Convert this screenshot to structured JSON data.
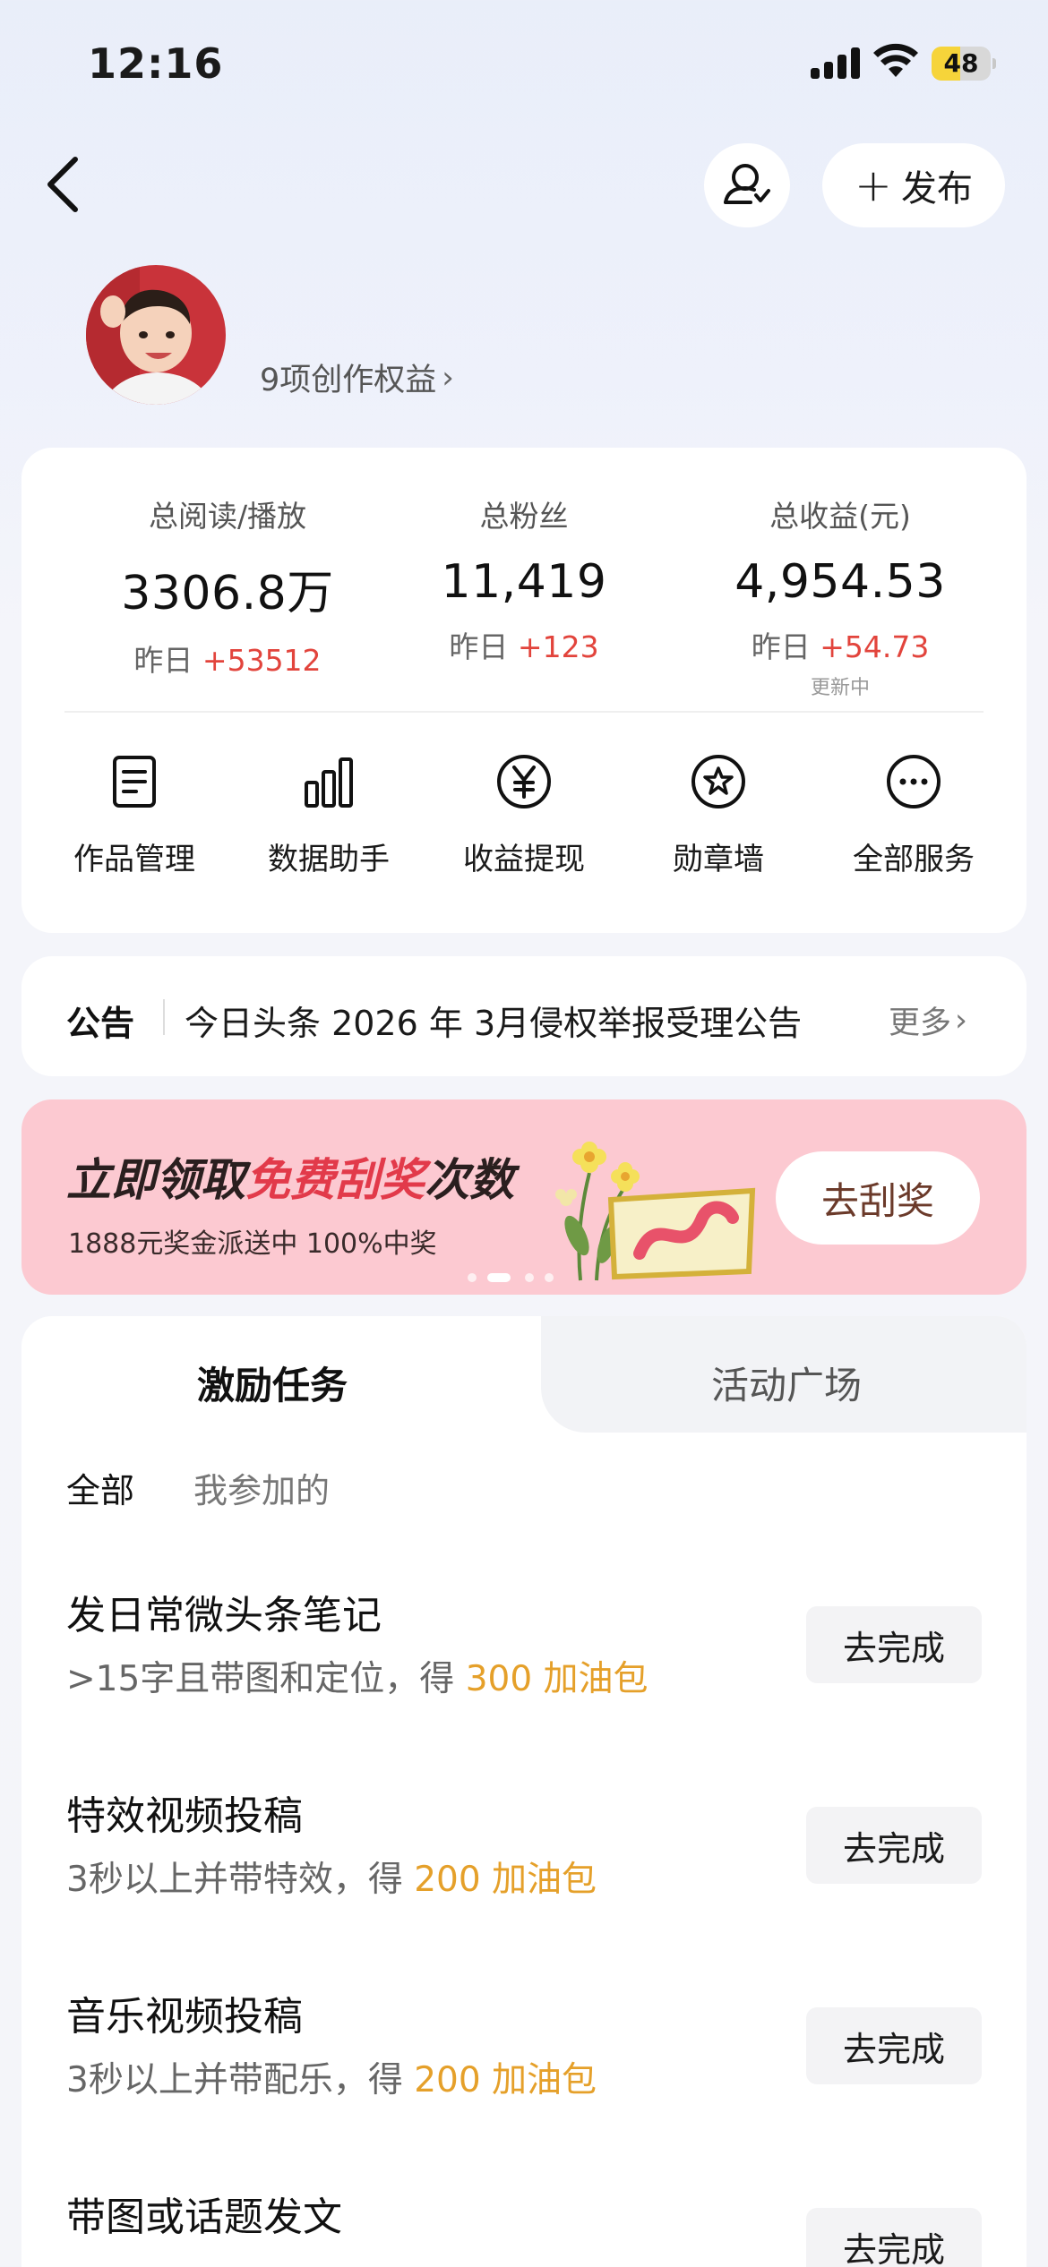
{
  "status_bar": {
    "time": "12:16",
    "battery": "48",
    "battery_level": 0.48
  },
  "header": {
    "publish_label": "发布"
  },
  "profile": {
    "rights_link": "9项创作权益"
  },
  "stats": [
    {
      "label": "总阅读/播放",
      "value": "3306.8万",
      "change_prefix": "昨日",
      "change": "+53512"
    },
    {
      "label": "总粉丝",
      "value": "11,419",
      "change_prefix": "昨日",
      "change": "+123"
    },
    {
      "label": "总收益(元)",
      "value": "4,954.53",
      "change_prefix": "昨日",
      "change": "+54.73",
      "note": "更新中"
    }
  ],
  "services": [
    {
      "label": "作品管理",
      "icon": "document-icon"
    },
    {
      "label": "数据助手",
      "icon": "bar-chart-icon"
    },
    {
      "label": "收益提现",
      "icon": "yuan-icon"
    },
    {
      "label": "勋章墙",
      "icon": "badge-icon"
    },
    {
      "label": "全部服务",
      "icon": "more-icon"
    }
  ],
  "notice": {
    "title": "公告",
    "text": "今日头条 2026 年 3月侵权举报受理公告",
    "more": "更多"
  },
  "banner": {
    "title_part1": "立即领取",
    "title_highlight": "免费刮奖",
    "title_part2": "次数",
    "subtitle": "1888元奖金派送中 100%中奖",
    "button": "去刮奖",
    "highlight_color": "#e23a4a"
  },
  "tasks": {
    "tabs": [
      "激励任务",
      "活动广场"
    ],
    "filters": [
      "全部",
      "我参加的"
    ],
    "items": [
      {
        "title": "发日常微头条笔记",
        "desc": ">15字且带图和定位，得 ",
        "reward": "300 加油包",
        "button": "去完成"
      },
      {
        "title": "特效视频投稿",
        "desc": "3秒以上并带特效，得 ",
        "reward": "200 加油包",
        "button": "去完成"
      },
      {
        "title": "音乐视频投稿",
        "desc": "3秒以上并带配乐，得 ",
        "reward": "200 加油包",
        "button": "去完成"
      },
      {
        "title": "带图或话题发文",
        "desc": "",
        "reward": "",
        "button": "去完成"
      }
    ]
  },
  "colors": {
    "accent_red": "#e2443c",
    "reward_orange": "#e5a02a",
    "banner_pink": "#fcc9d1"
  }
}
